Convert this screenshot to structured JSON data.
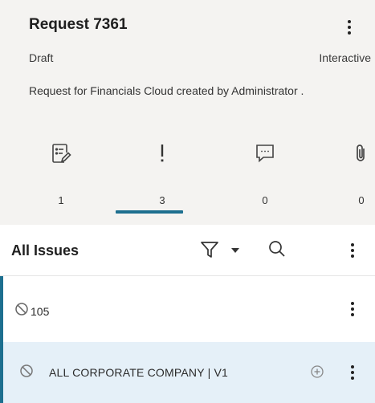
{
  "request": {
    "title": "Request 7361",
    "status": "Draft",
    "mode": "Interactive",
    "description": "Request for Financials Cloud created by Administrator ."
  },
  "stats": [
    {
      "icon": "notes-edit-icon",
      "count": "1"
    },
    {
      "icon": "exclamation-icon",
      "count": "3"
    },
    {
      "icon": "comment-icon",
      "count": "0"
    },
    {
      "icon": "paperclip-icon",
      "count": "0"
    }
  ],
  "issues": {
    "title": "All Issues",
    "rows": [
      {
        "label": "105",
        "icon": "blocked-icon"
      },
      {
        "label": "ALL CORPORATE COMPANY | V1",
        "icon": "blocked-icon"
      }
    ]
  },
  "colors": {
    "header_bg": "#f4f3f1",
    "accent": "#1d6f8f",
    "selected_row_bg": "#e5f0f8"
  }
}
